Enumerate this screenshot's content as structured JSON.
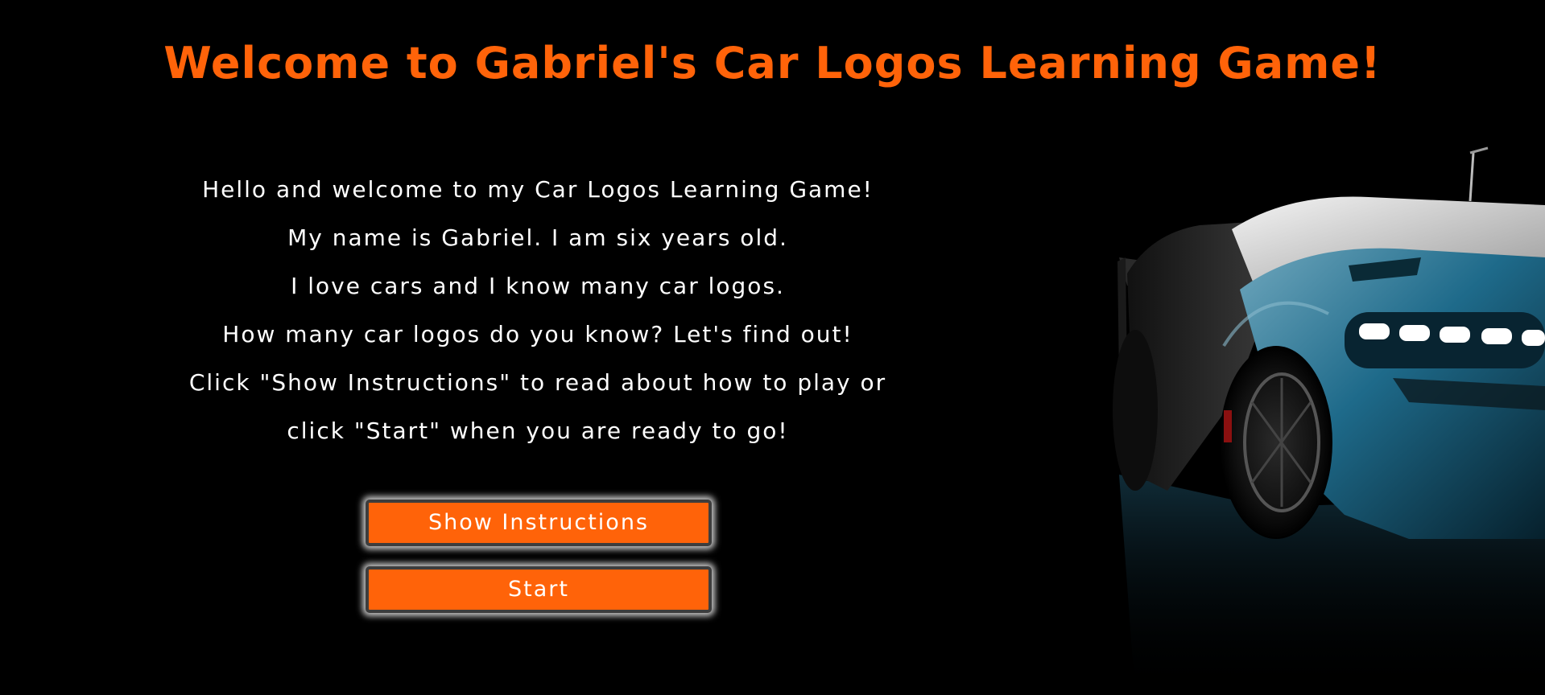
{
  "page": {
    "title": "Welcome to Gabriel's Car Logos Learning Game!"
  },
  "intro": {
    "lines": [
      "Hello and welcome to my Car Logos Learning Game!",
      "My name is Gabriel. I am six years old.",
      "I love cars and I know many car logos.",
      "How many car logos do you know? Let's find out!",
      "Click \"Show Instructions\" to read about how to play or",
      "click \"Start\" when you are ready to go!"
    ]
  },
  "buttons": {
    "show_instructions": "Show Instructions",
    "start": "Start"
  },
  "colors": {
    "accent": "#ff6309",
    "background": "#000000",
    "text": "#ffffff",
    "car_body": "#1e6a8a"
  },
  "image": {
    "subject": "sports-car-icon"
  }
}
